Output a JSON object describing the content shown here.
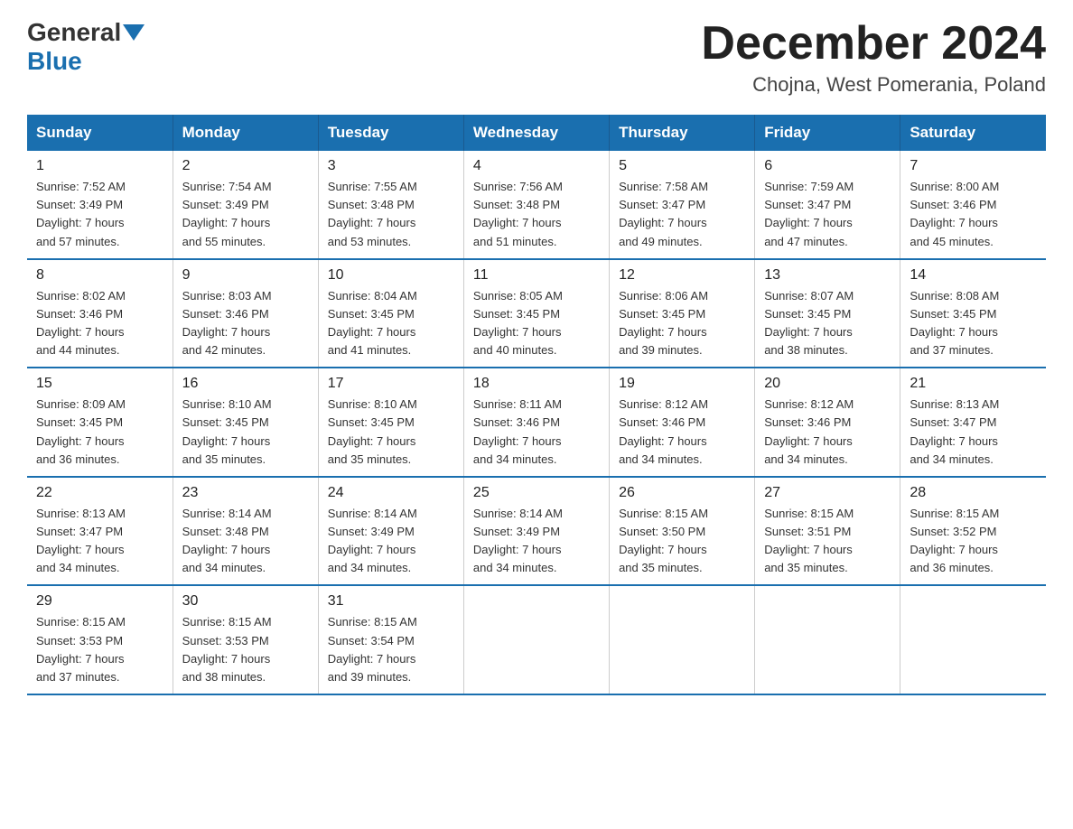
{
  "header": {
    "logo_general": "General",
    "logo_blue": "Blue",
    "month_title": "December 2024",
    "location": "Chojna, West Pomerania, Poland"
  },
  "days_of_week": [
    "Sunday",
    "Monday",
    "Tuesday",
    "Wednesday",
    "Thursday",
    "Friday",
    "Saturday"
  ],
  "weeks": [
    [
      {
        "day": "1",
        "info": "Sunrise: 7:52 AM\nSunset: 3:49 PM\nDaylight: 7 hours\nand 57 minutes."
      },
      {
        "day": "2",
        "info": "Sunrise: 7:54 AM\nSunset: 3:49 PM\nDaylight: 7 hours\nand 55 minutes."
      },
      {
        "day": "3",
        "info": "Sunrise: 7:55 AM\nSunset: 3:48 PM\nDaylight: 7 hours\nand 53 minutes."
      },
      {
        "day": "4",
        "info": "Sunrise: 7:56 AM\nSunset: 3:48 PM\nDaylight: 7 hours\nand 51 minutes."
      },
      {
        "day": "5",
        "info": "Sunrise: 7:58 AM\nSunset: 3:47 PM\nDaylight: 7 hours\nand 49 minutes."
      },
      {
        "day": "6",
        "info": "Sunrise: 7:59 AM\nSunset: 3:47 PM\nDaylight: 7 hours\nand 47 minutes."
      },
      {
        "day": "7",
        "info": "Sunrise: 8:00 AM\nSunset: 3:46 PM\nDaylight: 7 hours\nand 45 minutes."
      }
    ],
    [
      {
        "day": "8",
        "info": "Sunrise: 8:02 AM\nSunset: 3:46 PM\nDaylight: 7 hours\nand 44 minutes."
      },
      {
        "day": "9",
        "info": "Sunrise: 8:03 AM\nSunset: 3:46 PM\nDaylight: 7 hours\nand 42 minutes."
      },
      {
        "day": "10",
        "info": "Sunrise: 8:04 AM\nSunset: 3:45 PM\nDaylight: 7 hours\nand 41 minutes."
      },
      {
        "day": "11",
        "info": "Sunrise: 8:05 AM\nSunset: 3:45 PM\nDaylight: 7 hours\nand 40 minutes."
      },
      {
        "day": "12",
        "info": "Sunrise: 8:06 AM\nSunset: 3:45 PM\nDaylight: 7 hours\nand 39 minutes."
      },
      {
        "day": "13",
        "info": "Sunrise: 8:07 AM\nSunset: 3:45 PM\nDaylight: 7 hours\nand 38 minutes."
      },
      {
        "day": "14",
        "info": "Sunrise: 8:08 AM\nSunset: 3:45 PM\nDaylight: 7 hours\nand 37 minutes."
      }
    ],
    [
      {
        "day": "15",
        "info": "Sunrise: 8:09 AM\nSunset: 3:45 PM\nDaylight: 7 hours\nand 36 minutes."
      },
      {
        "day": "16",
        "info": "Sunrise: 8:10 AM\nSunset: 3:45 PM\nDaylight: 7 hours\nand 35 minutes."
      },
      {
        "day": "17",
        "info": "Sunrise: 8:10 AM\nSunset: 3:45 PM\nDaylight: 7 hours\nand 35 minutes."
      },
      {
        "day": "18",
        "info": "Sunrise: 8:11 AM\nSunset: 3:46 PM\nDaylight: 7 hours\nand 34 minutes."
      },
      {
        "day": "19",
        "info": "Sunrise: 8:12 AM\nSunset: 3:46 PM\nDaylight: 7 hours\nand 34 minutes."
      },
      {
        "day": "20",
        "info": "Sunrise: 8:12 AM\nSunset: 3:46 PM\nDaylight: 7 hours\nand 34 minutes."
      },
      {
        "day": "21",
        "info": "Sunrise: 8:13 AM\nSunset: 3:47 PM\nDaylight: 7 hours\nand 34 minutes."
      }
    ],
    [
      {
        "day": "22",
        "info": "Sunrise: 8:13 AM\nSunset: 3:47 PM\nDaylight: 7 hours\nand 34 minutes."
      },
      {
        "day": "23",
        "info": "Sunrise: 8:14 AM\nSunset: 3:48 PM\nDaylight: 7 hours\nand 34 minutes."
      },
      {
        "day": "24",
        "info": "Sunrise: 8:14 AM\nSunset: 3:49 PM\nDaylight: 7 hours\nand 34 minutes."
      },
      {
        "day": "25",
        "info": "Sunrise: 8:14 AM\nSunset: 3:49 PM\nDaylight: 7 hours\nand 34 minutes."
      },
      {
        "day": "26",
        "info": "Sunrise: 8:15 AM\nSunset: 3:50 PM\nDaylight: 7 hours\nand 35 minutes."
      },
      {
        "day": "27",
        "info": "Sunrise: 8:15 AM\nSunset: 3:51 PM\nDaylight: 7 hours\nand 35 minutes."
      },
      {
        "day": "28",
        "info": "Sunrise: 8:15 AM\nSunset: 3:52 PM\nDaylight: 7 hours\nand 36 minutes."
      }
    ],
    [
      {
        "day": "29",
        "info": "Sunrise: 8:15 AM\nSunset: 3:53 PM\nDaylight: 7 hours\nand 37 minutes."
      },
      {
        "day": "30",
        "info": "Sunrise: 8:15 AM\nSunset: 3:53 PM\nDaylight: 7 hours\nand 38 minutes."
      },
      {
        "day": "31",
        "info": "Sunrise: 8:15 AM\nSunset: 3:54 PM\nDaylight: 7 hours\nand 39 minutes."
      },
      {
        "day": "",
        "info": ""
      },
      {
        "day": "",
        "info": ""
      },
      {
        "day": "",
        "info": ""
      },
      {
        "day": "",
        "info": ""
      }
    ]
  ]
}
